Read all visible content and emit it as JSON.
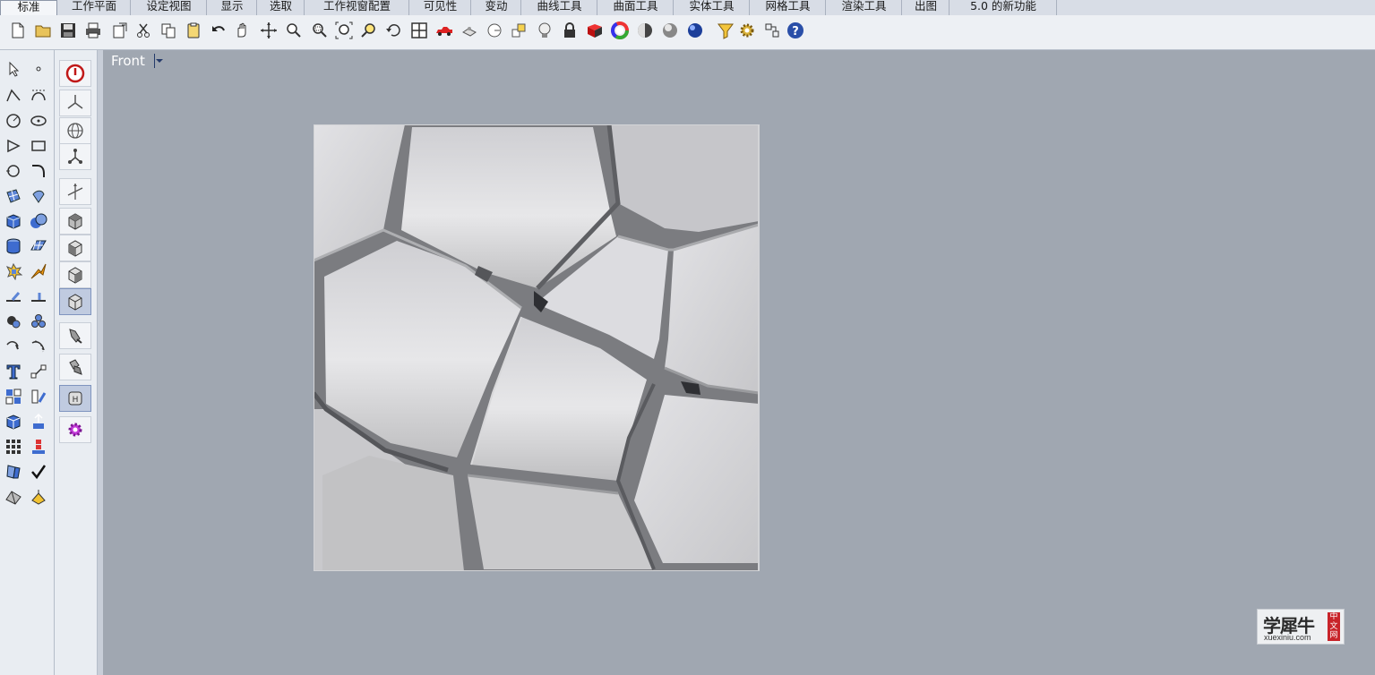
{
  "tabs": [
    {
      "label": "标准",
      "active": true
    },
    {
      "label": "工作平面"
    },
    {
      "label": "设定视图"
    },
    {
      "label": "显示"
    },
    {
      "label": "选取"
    },
    {
      "label": "工作视窗配置"
    },
    {
      "label": "可见性"
    },
    {
      "label": "变动"
    },
    {
      "label": "曲线工具"
    },
    {
      "label": "曲面工具"
    },
    {
      "label": "实体工具"
    },
    {
      "label": "网格工具"
    },
    {
      "label": "渲染工具"
    },
    {
      "label": "出图"
    },
    {
      "label": "5.0 的新功能"
    }
  ],
  "toolbar_icons": [
    "new-file-icon",
    "open-folder-icon",
    "save-icon",
    "print-icon",
    "import-icon",
    "cut-icon",
    "copy-icon",
    "paste-icon",
    "undo-icon",
    "pan-hand-icon",
    "rotate-view-icon",
    "zoom-icon",
    "zoom-window-icon",
    "zoom-extents-icon",
    "zoom-selected-icon",
    "rotate-camera-icon",
    "four-viewports-icon",
    "car-icon",
    "capture-icon",
    "circle-view-icon",
    "layer-icon",
    "lightbulb-icon",
    "lock-icon",
    "material-icon",
    "color-wheel-icon",
    "shaded-sphere-icon",
    "rendered-sphere-icon",
    "blue-sphere-icon",
    "filter-icon",
    "settings-gear-icon",
    "snap-icon",
    "help-icon"
  ],
  "viewport": {
    "title": "Front"
  },
  "watermark": {
    "main": "学犀牛",
    "sub": "xuexiniu.com",
    "side": "中文网"
  },
  "colors": {
    "viewport_bg": "#a0a7b1",
    "panel_bg": "#e9edf2",
    "accent_red": "#c8242a"
  }
}
